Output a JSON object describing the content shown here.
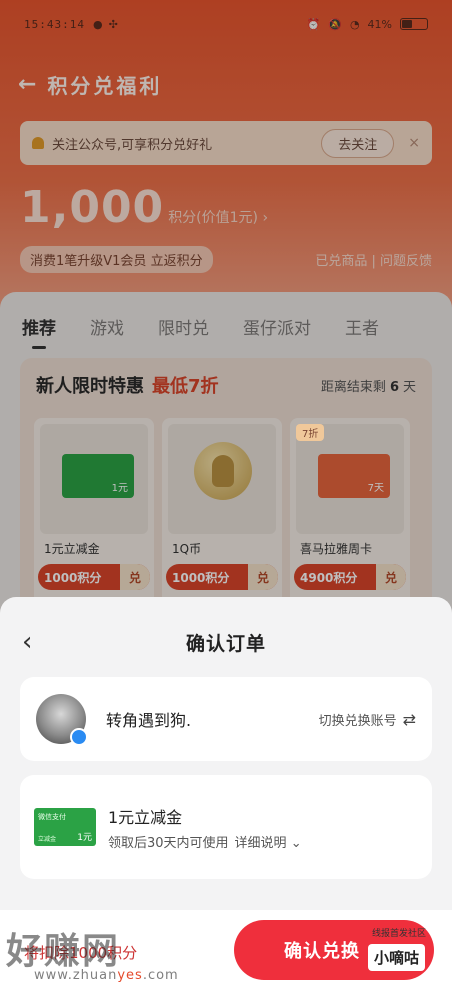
{
  "status_bar": {
    "time": "15:43:14",
    "battery": "41%"
  },
  "page": {
    "title": "积分兑福利",
    "follow_tip": "关注公众号,可享积分兑好礼",
    "follow_button": "去关注",
    "close": "×",
    "points_value": "1,000",
    "points_unit": "积分(价值1元) ›",
    "upgrade_badge": "消费1笔升级V1会员 立返积分",
    "links": "已兑商品 | 问题反馈"
  },
  "tabs": [
    "推荐",
    "游戏",
    "限时兑",
    "蛋仔派对",
    "王者"
  ],
  "promo": {
    "title": "新人限时特惠",
    "highlight": "最低7折",
    "countdown_prefix": "距离结束剩",
    "countdown_days": "6",
    "countdown_suffix": "天",
    "cards": [
      {
        "name": "1元立减金",
        "points": "1000积分",
        "exchange": "兑",
        "thumb_amount": "1元"
      },
      {
        "name": "1Q币",
        "points": "1000积分",
        "exchange": "兑"
      },
      {
        "name": "喜马拉雅周卡",
        "points": "4900积分",
        "exchange": "兑",
        "tag": "7折",
        "thumb_amount": "7天"
      }
    ]
  },
  "sheet": {
    "title": "确认订单",
    "account_name": "转角遇到狗.",
    "switch_account": "切换兑换账号",
    "product_name": "1元立减金",
    "product_desc": "领取后30天内可使用",
    "detail_link": "详细说明",
    "thumb_wechat": "微信支付",
    "thumb_sub": "立减金",
    "thumb_amount": "1元",
    "points_note": "将扣除1000积分",
    "confirm_button": "确认兑换"
  },
  "watermarks": {
    "left": "好赚网",
    "left_url_a": "www.zhuan",
    "left_url_b": "yes",
    "left_url_c": ".com",
    "right_top": "线报首发社区",
    "right_badge": "小嘀咕",
    "right_url": "xdgit.com"
  }
}
